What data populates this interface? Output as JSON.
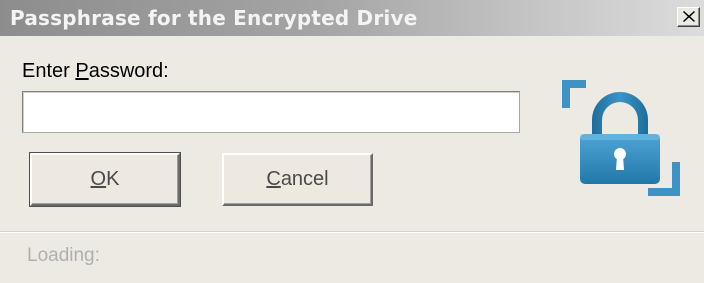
{
  "window": {
    "title": "Passphrase for the Encrypted Drive",
    "close_symbol": "×"
  },
  "form": {
    "password_label_before": "Enter ",
    "password_label_accel": "P",
    "password_label_after": "assword:",
    "password_value": "",
    "password_placeholder": ""
  },
  "buttons": {
    "ok_accel": "O",
    "ok_rest": "K",
    "cancel_accel": "C",
    "cancel_rest": "ancel"
  },
  "status": {
    "text": "Loading:"
  },
  "icons": {
    "close": "close-icon",
    "lock": "padlock-icon"
  },
  "colors": {
    "lock_body": "#2e86b6",
    "lock_dark": "#1b5f8c",
    "corner_brackets": "#3f92c4"
  }
}
